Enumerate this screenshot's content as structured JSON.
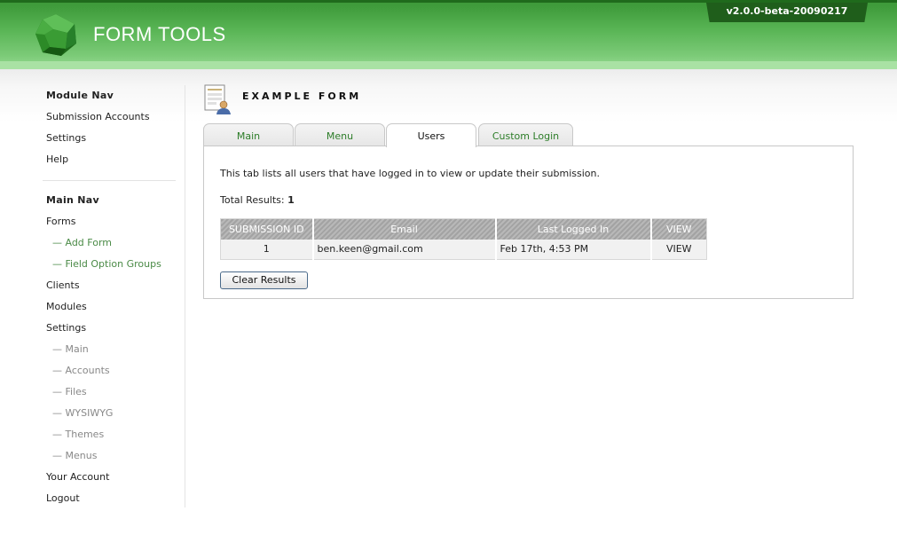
{
  "app": {
    "logo_text": "FORM TOOLS",
    "version": "v2.0.0-beta-20090217"
  },
  "sidebar": {
    "module_nav_heading": "Module Nav",
    "module_items": [
      "Submission Accounts",
      "Settings",
      "Help"
    ],
    "main_nav_heading": "Main Nav",
    "main_items": {
      "forms": "Forms",
      "add_form": "— Add Form",
      "field_option_groups": "— Field Option Groups",
      "clients": "Clients",
      "modules": "Modules",
      "settings": "Settings",
      "settings_main": "— Main",
      "settings_accounts": "— Accounts",
      "settings_files": "— Files",
      "settings_wysiwyg": "— WYSIWYG",
      "settings_themes": "— Themes",
      "settings_menus": "— Menus",
      "your_account": "Your Account",
      "logout": "Logout"
    }
  },
  "form": {
    "title": "EXAMPLE FORM",
    "icon": "form-user-icon"
  },
  "tabs": [
    "Main",
    "Menu",
    "Users",
    "Custom Login"
  ],
  "active_tab": "Users",
  "content": {
    "intro": "This tab lists all users that have logged in to view or update their submission.",
    "total_label": "Total Results:",
    "total_value": "1",
    "table": {
      "headers": [
        "SUBMISSION ID",
        "Email",
        "Last Logged In",
        "VIEW"
      ],
      "rows": [
        [
          "1",
          "ben.keen@gmail.com",
          "Feb 17th, 4:53 PM",
          "VIEW"
        ]
      ]
    },
    "clear_button": "Clear Results"
  },
  "colors": {
    "brand_green": "#3f9b3b",
    "link_green": "#2c7d28",
    "version_bg": "#1f5e1b"
  }
}
